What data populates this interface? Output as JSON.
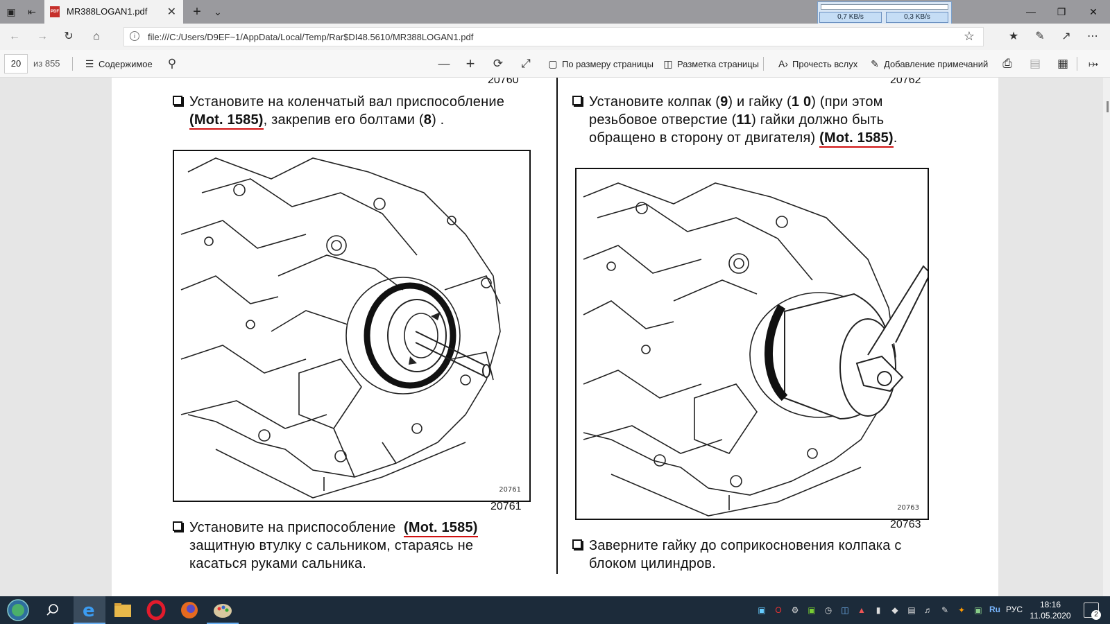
{
  "browser": {
    "tab_title": "MR388LOGAN1.pdf",
    "url": "file:///C:/Users/D9EF~1/AppData/Local/Temp/Rar$DI48.5610/MR388LOGAN1.pdf"
  },
  "netmeter": {
    "down": "0,7 KB/s",
    "up": "0,3 KB/s"
  },
  "pdf_toolbar": {
    "page_number": "20",
    "page_total": "из 855",
    "contents_label": "Содержимое",
    "fit_page_label": "По размеру страницы",
    "page_layout_label": "Разметка страницы",
    "read_aloud_label": "Прочесть вслух",
    "add_notes_label": "Добавление примечаний"
  },
  "document": {
    "left": {
      "top_fig_number": "20760",
      "para1_pre": "Установите на коленчатый вал приспособление",
      "para1_mot": "(Mot. 1585)",
      "para1_post": ", закрепив его болтами (",
      "para1_num": "8",
      "para1_end": ") .",
      "figure_ref": "20761",
      "figure_number": "20761",
      "para2_pre": "Установите на приспособление",
      "para2_mot": "(Mot.  1585)",
      "para2_line2": "защитную втулку с   сальником, стараясь   не",
      "para2_line3": "касаться руками сальника."
    },
    "right": {
      "top_fig_number": "20762",
      "para1_a": "Установите  колпак  (",
      "para1_n9": "9",
      "para1_b": ")  и  гайку  (",
      "para1_n10": "1 0",
      "para1_c": ")  (при  этом",
      "para1_line2_a": "резьбовое   отверстие  (",
      "para1_n11": "11",
      "para1_line2_b": ")  гайки должно  быть",
      "para1_line3": "обращено в сторону от двигателя)",
      "para1_mot": "(Mot. 1585)",
      "para1_dot": ".",
      "figure_ref": "20763",
      "figure_number": "20763",
      "para2_line1": "Заверните гайку до соприкосновения колпака с",
      "para2_line2": "блоком цилиндров."
    }
  },
  "taskbar": {
    "lang_short": "Ru",
    "lang": "РУС",
    "time": "18:16",
    "date": "11.05.2020",
    "notifications": "2"
  }
}
